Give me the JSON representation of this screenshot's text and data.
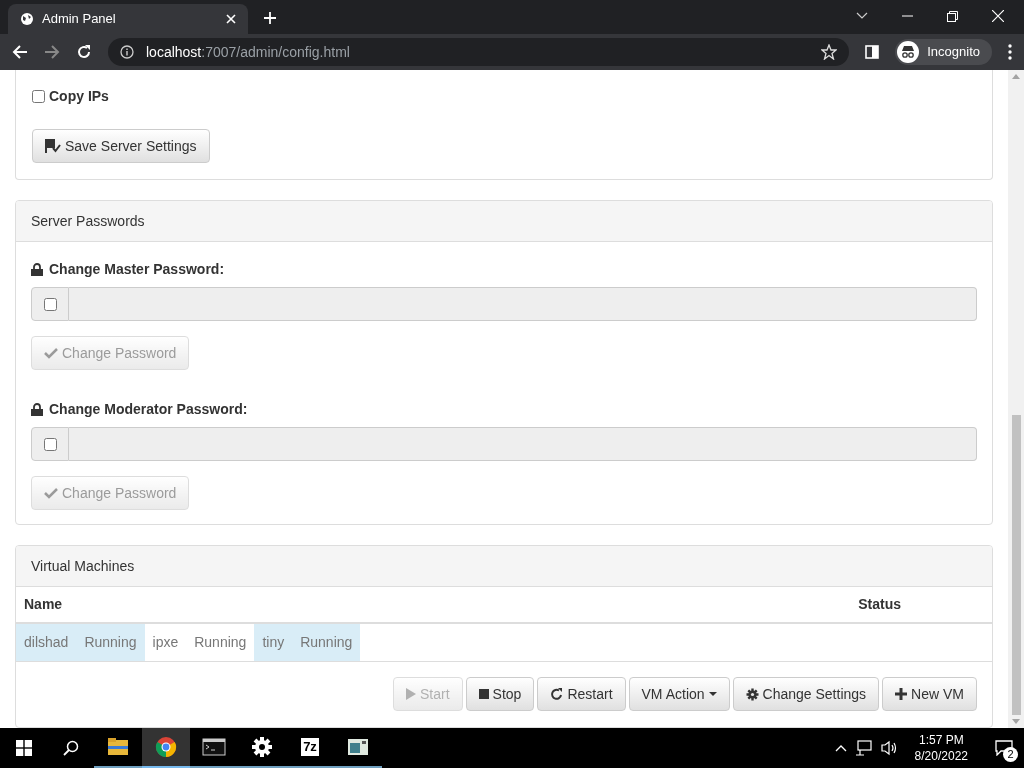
{
  "browser": {
    "tab_title": "Admin Panel",
    "url_host": "localhost",
    "url_rest": ":7007/admin/config.html",
    "profile": "Incognito"
  },
  "server_settings": {
    "checkboxes": [
      {
        "label": "Copy IPs",
        "checked": false
      }
    ],
    "save_button": "Save Server Settings"
  },
  "passwords": {
    "title": "Server Passwords",
    "fields": [
      {
        "label": "Change Master Password:",
        "checked": false,
        "button": "Change Password",
        "disabled": true
      },
      {
        "label": "Change Moderator Password:",
        "checked": false,
        "button": "Change Password",
        "disabled": true
      }
    ]
  },
  "vms": {
    "title": "Virtual Machines",
    "columns": [
      "Name",
      "Status"
    ],
    "rows": [
      {
        "name": "dilshad",
        "status": "Running",
        "selected": true
      },
      {
        "name": "ipxe",
        "status": "Running",
        "selected": false
      },
      {
        "name": "tiny",
        "status": "Running",
        "selected": true
      }
    ],
    "buttons": [
      {
        "label": "Start",
        "kind": "play",
        "disabled": true
      },
      {
        "label": "Stop",
        "kind": "stop",
        "disabled": false
      },
      {
        "label": "Restart",
        "kind": "restart",
        "disabled": false
      },
      {
        "label": "VM Action",
        "kind": "dropdown",
        "disabled": false
      },
      {
        "label": "Change Settings",
        "kind": "settings",
        "disabled": false
      },
      {
        "label": "New VM",
        "kind": "add",
        "disabled": false
      }
    ]
  },
  "taskbar": {
    "apps": [
      {
        "kind": "explorer",
        "selected": false
      },
      {
        "kind": "chrome",
        "selected": true
      },
      {
        "kind": "terminal",
        "selected": false
      },
      {
        "kind": "settings",
        "selected": false
      },
      {
        "kind": "archiver",
        "label": "7z",
        "selected": false
      },
      {
        "kind": "window",
        "selected": false
      }
    ],
    "time": "1:57 PM",
    "date": "8/20/2022",
    "notifications": "2"
  }
}
